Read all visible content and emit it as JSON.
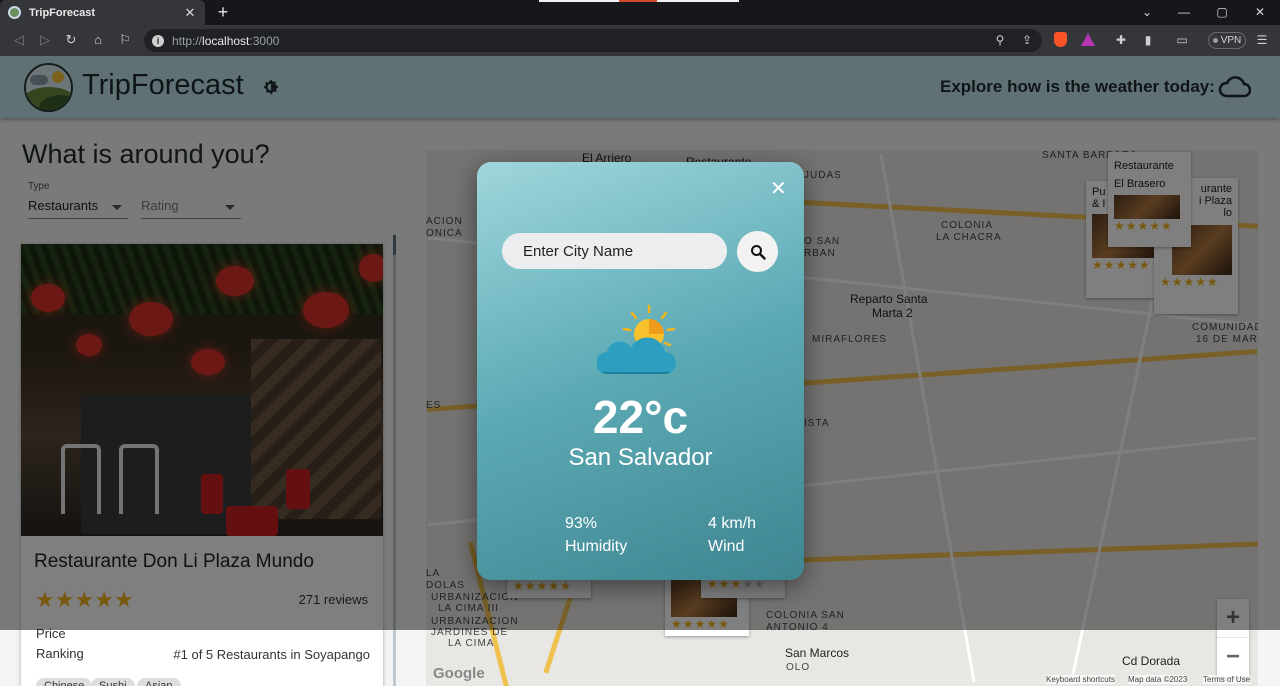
{
  "browser": {
    "tab_title": "TripForecast",
    "tab_close": "✕",
    "new_tab": "+",
    "url_protocol": "http://",
    "url_host": "localhost",
    "url_port": ":3000",
    "vpn_label": "VPN",
    "window_controls": [
      "⌄",
      "—",
      "▢",
      "✕"
    ]
  },
  "header": {
    "app_name": "TripForecast",
    "explore_text": "Explore how is the weather today:"
  },
  "sidebar": {
    "heading": "What is around you?",
    "type_label": "Type",
    "type_value": "Restaurants",
    "rating_placeholder": "Rating"
  },
  "place_card": {
    "title": "Restaurante Don Li Plaza Mundo",
    "rating": 5,
    "reviews": "271 reviews",
    "price_label": "Price",
    "ranking_label": "Ranking",
    "ranking_value": "#1 of 5 Restaurants in Soyapango",
    "cuisines": [
      "Chinese",
      "Sushi",
      "Asian"
    ]
  },
  "map": {
    "labels": [
      "El Arriero",
      "Restaurante",
      "SANTA BARBARA",
      "JUDAS",
      "COLONIA",
      "LA CHACRA",
      "O SAN",
      "RBAN",
      "Reparto Santa",
      "Marta 2",
      "MIRAFLORES",
      "ACION",
      "ONICA",
      "COMUNIDAD",
      "16 DE MARZ",
      "LA",
      "ISTA",
      "URBANIZACION",
      "LA CIMA III",
      "URBANIZACION",
      "JARDINES DE",
      "LA CIMA",
      "COLONIA SAN",
      "ANTONIO 4",
      "San Marcos",
      "Cd Dorada",
      "DOLAS",
      "ES",
      "OLO"
    ],
    "markers": [
      {
        "name": "Restaurante El Brasero",
        "stars": 5
      },
      {
        "name": "Pu",
        "name2": "& I",
        "stars": 5
      },
      {
        "name": "urante",
        "name2": "i Plaza",
        "name3": "lo",
        "stars": 5
      },
      {
        "stars": 5
      },
      {
        "stars": 5
      },
      {
        "stars": 3
      }
    ],
    "zoom_in": "+",
    "zoom_out": "−",
    "google": "Google",
    "attribution": [
      "Keyboard shortcuts",
      "Map data ©2023",
      "Terms of Use"
    ]
  },
  "weather_modal": {
    "search_placeholder": "Enter City Name",
    "temperature": "22°c",
    "city": "San Salvador",
    "humidity_value": "93%",
    "humidity_label": "Humidity",
    "wind_value": "4 km/h",
    "wind_label": "Wind",
    "condition_icon": "partly-cloudy-icon"
  },
  "colors": {
    "header_bg": "#bfe3e8",
    "star": "#f2b01e",
    "modal_gradient_start": "#9fd6dc",
    "modal_gradient_end": "#3e8590"
  }
}
